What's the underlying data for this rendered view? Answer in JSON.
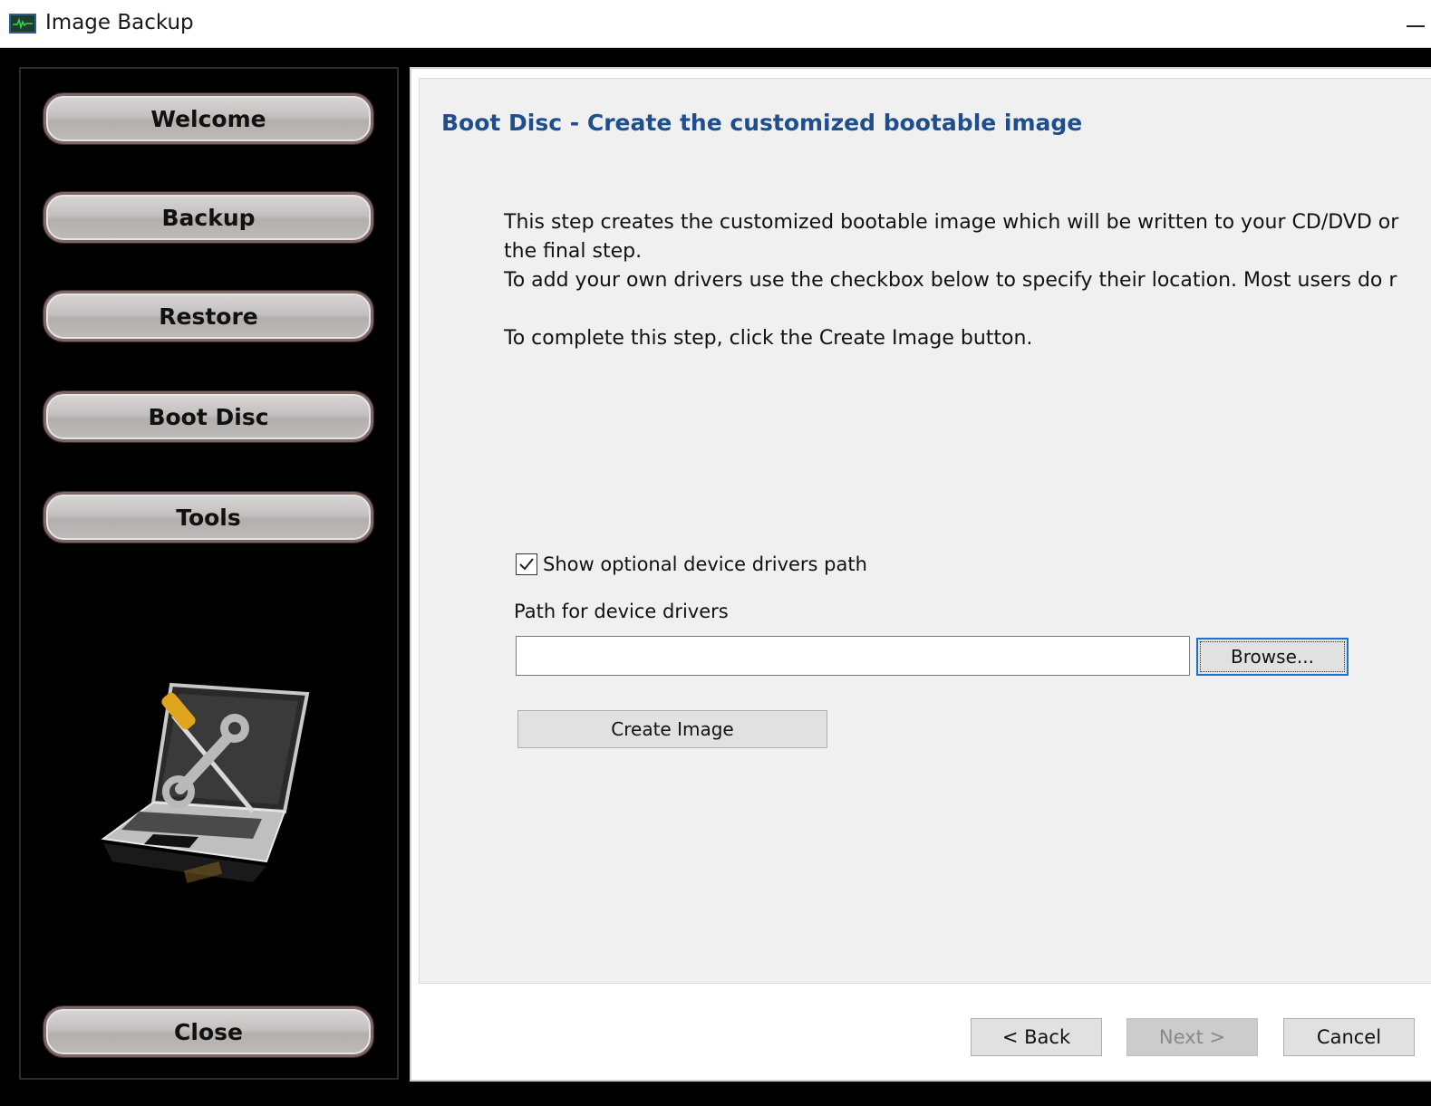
{
  "window": {
    "title": "Image Backup",
    "icon": "pulse-monitor-icon"
  },
  "sidebar": {
    "items": [
      {
        "label": "Welcome"
      },
      {
        "label": "Backup"
      },
      {
        "label": "Restore"
      },
      {
        "label": "Boot Disc"
      },
      {
        "label": "Tools"
      }
    ],
    "close_label": "Close",
    "illustration": "laptop-with-tools-icon"
  },
  "main": {
    "title": "Boot Disc - Create the customized bootable image",
    "description": [
      "This step creates the customized bootable image which will be written to your CD/DVD or",
      "the final step.",
      "To add your own drivers use the checkbox below to specify their location. Most users do r",
      "To complete this step, click the Create Image button."
    ],
    "checkbox_label": "Show optional device drivers path",
    "checkbox_checked": true,
    "path_label": "Path for device drivers",
    "path_value": "",
    "browse_label": "Browse...",
    "create_image_label": "Create Image"
  },
  "footer": {
    "back_label": "< Back",
    "next_label": "Next >",
    "cancel_label": "Cancel",
    "next_enabled": false
  },
  "colors": {
    "title_blue": "#1f4e8f",
    "focus_blue": "#1e6fd0"
  }
}
